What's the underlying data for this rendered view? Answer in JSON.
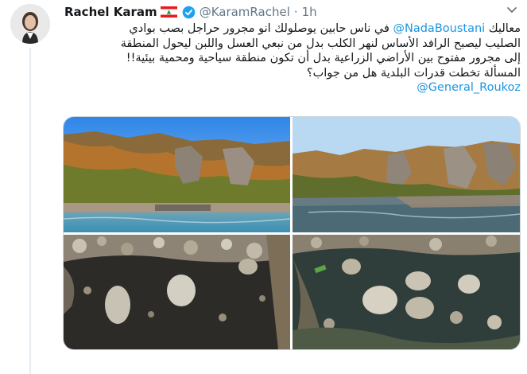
{
  "author": {
    "name": "Rachel Karam",
    "handle": "@KaramRachel",
    "separator": "·",
    "time": "1h",
    "flag_colors": {
      "red": "#ee161f",
      "white": "#ffffff",
      "cedar": "#00a850"
    },
    "verified_color": "#1da1f2"
  },
  "tweet": {
    "line1_a": "معاليك ",
    "line1_mention": "@NadaBoustani",
    "line1_b": " في ناس حابين يوصلولك انو مجرور حراجل بصب بوادي",
    "line2": "الصليب ليصبح الرافد الأساس لنهر الكلب بدل من نبعي العسل واللبن ليحول المنطقة",
    "line3": "إلى مجرور مفتوح بين الأراضي الزراعية بدل أن تكون منطقة سياحية ومحمية بيئية!!",
    "line4": "المسألة تخطت قدرات البلدية هل من جواب؟",
    "line5_mention": "@General_Roukoz"
  },
  "media": {
    "images": [
      {
        "name": "river-valley-photo-1",
        "icon": "photo"
      },
      {
        "name": "river-valley-photo-2",
        "icon": "photo"
      },
      {
        "name": "riverbed-rocks-photo-1",
        "icon": "photo"
      },
      {
        "name": "riverbed-rocks-photo-2",
        "icon": "photo"
      }
    ]
  },
  "colors": {
    "mention": "#1b95e0",
    "text": "#14171a",
    "meta": "#657786"
  }
}
